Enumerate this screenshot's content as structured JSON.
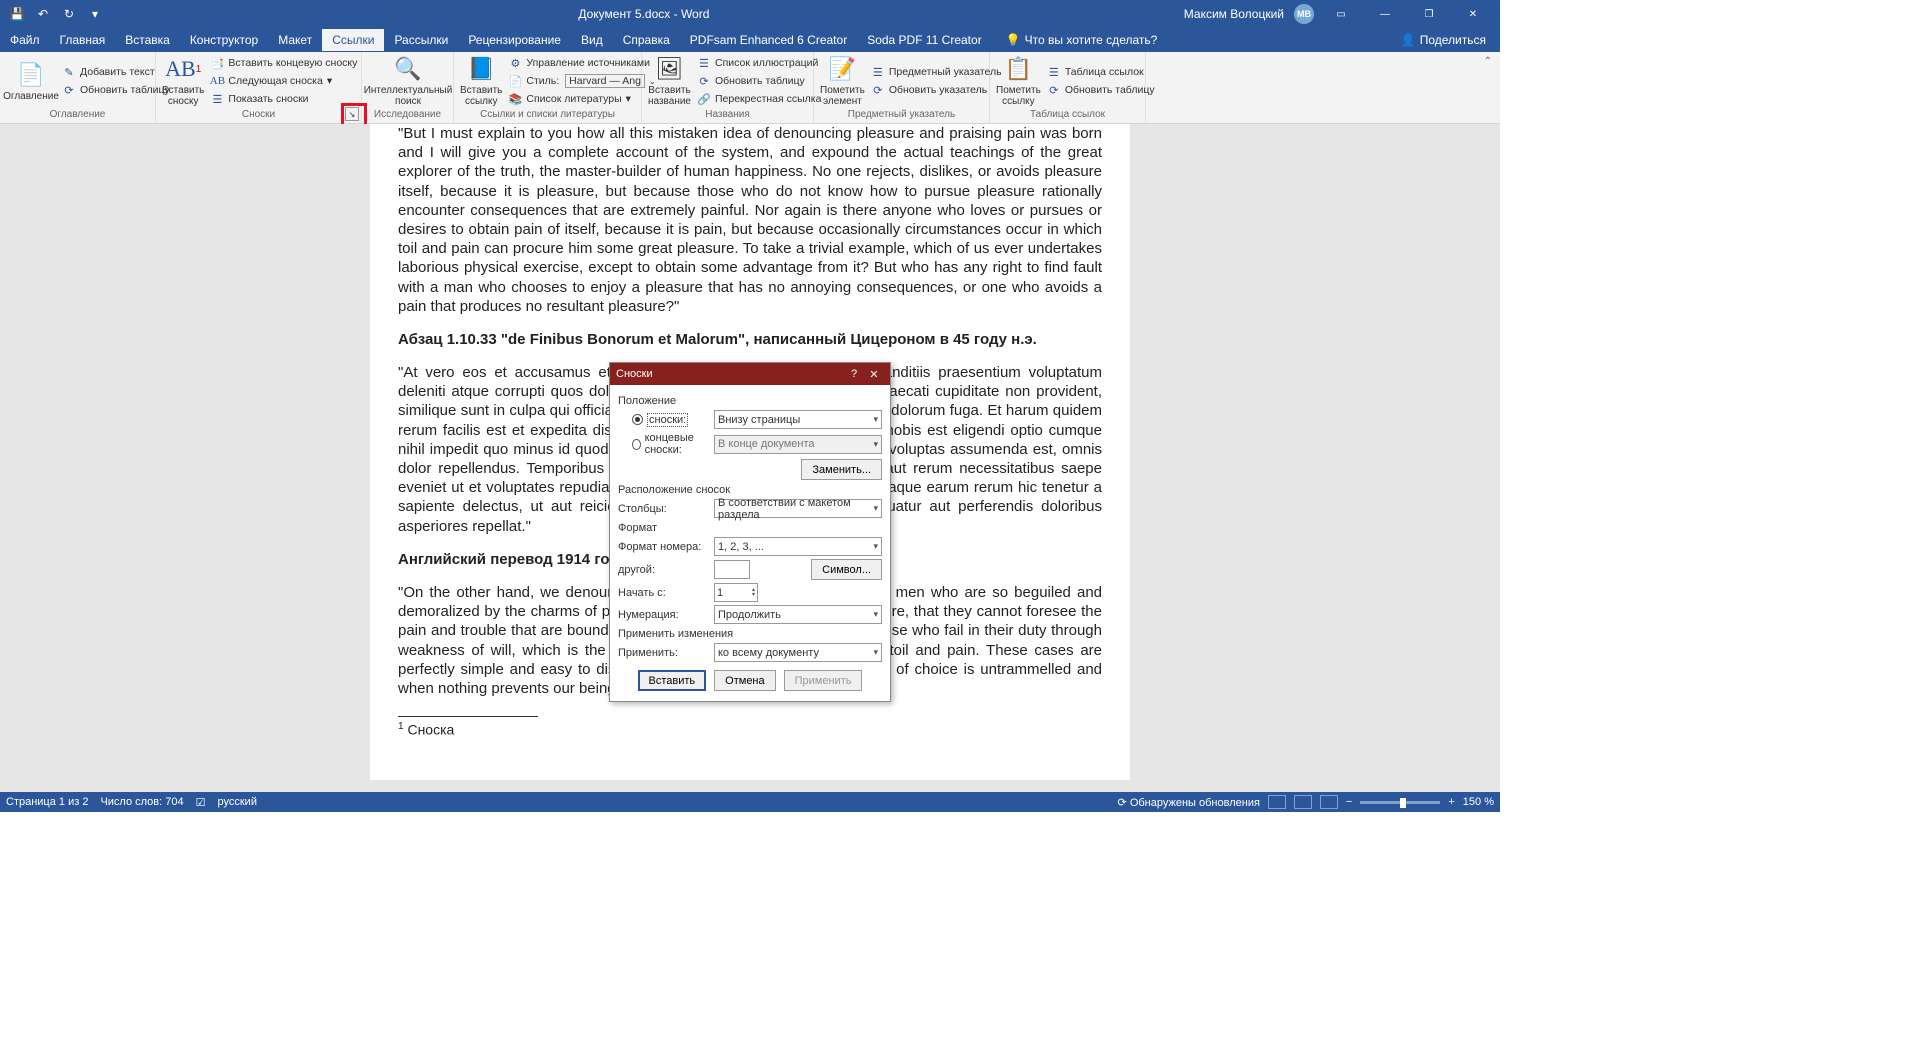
{
  "titlebar": {
    "doc_title": "Документ 5.docx  -  Word",
    "user_name": "Максим Волоцкий",
    "user_initials": "МВ"
  },
  "menu": {
    "file": "Файл",
    "tabs": [
      "Главная",
      "Вставка",
      "Конструктор",
      "Макет",
      "Ссылки",
      "Рассылки",
      "Рецензирование",
      "Вид",
      "Справка",
      "PDFsam Enhanced 6 Creator",
      "Soda PDF 11 Creator"
    ],
    "active": "Ссылки",
    "tellme": "Что вы хотите сделать?",
    "share": "Поделиться"
  },
  "ribbon": {
    "toc": {
      "btn": "Оглавление",
      "add_text": "Добавить текст",
      "update": "Обновить таблицу",
      "group": "Оглавление"
    },
    "footnotes": {
      "insert": "Вставить сноску",
      "end": "Вставить концевую сноску",
      "next": "Следующая сноска",
      "show": "Показать сноски",
      "group": "Сноски"
    },
    "research": {
      "btn": "Интеллектуальный поиск",
      "group": "Исследование"
    },
    "citations": {
      "insert": "Вставить ссылку",
      "manage": "Управление источниками",
      "style_lbl": "Стиль:",
      "style_val": "Harvard — Ang",
      "biblio": "Список литературы",
      "group": "Ссылки и списки литературы"
    },
    "captions": {
      "insert": "Вставить название",
      "list": "Список иллюстраций",
      "update": "Обновить таблицу",
      "cross": "Перекрестная ссылка",
      "group": "Названия"
    },
    "index": {
      "mark": "Пометить элемент",
      "subj": "Предметный указатель",
      "update": "Обновить указатель",
      "group": "Предметный указатель"
    },
    "toa": {
      "mark": "Пометить ссылку",
      "table": "Таблица ссылок",
      "update": "Обновить таблицу",
      "group": "Таблица ссылок"
    }
  },
  "document": {
    "p1": "\"But I must explain to you how all this mistaken idea of denouncing pleasure and praising pain was born and I will give you a complete account of the system, and expound the actual teachings of the great explorer of the truth, the master-builder of human happiness. No one rejects, dislikes, or avoids pleasure itself, because it is pleasure, but because those who do not know how to pursue pleasure rationally encounter consequences that are extremely painful. Nor again is there anyone who loves or pursues or desires to obtain pain of itself, because it is pain, but because occasionally circumstances occur in which toil and pain can procure him some great pleasure. To take a trivial example, which of us ever undertakes laborious physical exercise, except to obtain some advantage from it? But who has any right to find fault with a man who chooses to enjoy a pleasure that has no annoying consequences, or one who avoids a pain that produces no resultant pleasure?\"",
    "h1": "Абзац 1.10.33 \"de Finibus Bonorum et Malorum\", написанный Цицероном в 45 году н.э.",
    "p2": "\"At vero eos et accusamus et iusto odio dignissimos ducimus qui blanditiis praesentium voluptatum deleniti atque corrupti quos dolores et quas molestias excepturi sint occaecati cupiditate non provident, similique sunt in culpa qui officia deserunt mollitia animi, id est laborum et dolorum fuga. Et harum quidem rerum facilis est et expedita distinctio. Nam libero tempore, cum soluta nobis est eligendi optio cumque nihil impedit quo minus id quod maxime placeat facere possimus, omnis voluptas assumenda est, omnis dolor repellendus. Temporibus autem quibusdam et aut officiis debitis aut rerum necessitatibus saepe eveniet ut et voluptates repudiandae sint et molestiae non recusandae. Itaque earum rerum hic tenetur a sapiente delectus, ut aut reiciendis voluptatibus maiores alias consequatur aut perferendis doloribus asperiores repellat.\"",
    "h2": "Английский перевод 1914 года, H. Rackham",
    "p3": "\"On the other hand, we denounce with righteous indignation and dislike men who are so beguiled and demoralized by the charms of pleasure of the moment, so blinded by desire, that they cannot foresee the pain and trouble that are bound to ensue; and equal blame belongs to those who fail in their duty through weakness of will, which is the same as saying through shrinking from toil and pain. These cases are perfectly simple and easy to distinguish. In a free hour, when our power of choice is untrammelled and when nothing prevents our being able to do what we like best, every",
    "fn": "Сноска"
  },
  "dialog": {
    "title": "Сноски",
    "sec_position": "Положение",
    "radio_footnotes": "сноски:",
    "radio_endnotes": "концевые сноски:",
    "val_footnotes": "Внизу страницы",
    "val_endnotes": "В конце документа",
    "btn_replace": "Заменить...",
    "sec_layout": "Расположение сносок",
    "lbl_columns": "Столбцы:",
    "val_columns": "В соответствии с макетом раздела",
    "sec_format": "Формат",
    "lbl_numformat": "Формат номера:",
    "val_numformat": "1, 2, 3, ...",
    "lbl_other": "другой:",
    "btn_symbol": "Символ...",
    "lbl_start": "Начать с:",
    "val_start": "1",
    "lbl_numbering": "Нумерация:",
    "val_numbering": "Продолжить",
    "sec_apply": "Применить изменения",
    "lbl_applyto": "Применить:",
    "val_applyto": "ко всему документу",
    "btn_insert": "Вставить",
    "btn_cancel": "Отмена",
    "btn_apply": "Применить"
  },
  "status": {
    "page": "Страница 1 из 2",
    "words": "Число слов: 704",
    "lang": "русский",
    "updates": "Обнаружены обновления",
    "zoom": "150 %"
  }
}
